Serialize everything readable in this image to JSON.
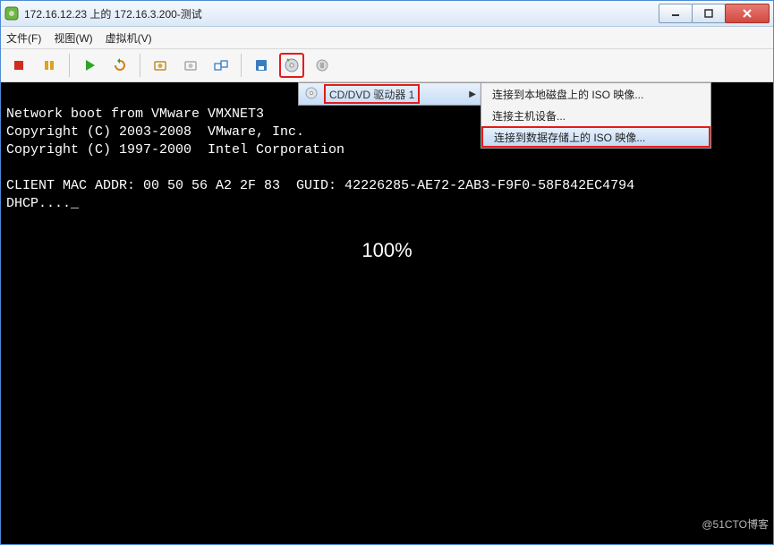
{
  "titlebar": {
    "title": "172.16.12.23 上的 172.16.3.200-测试"
  },
  "menubar": {
    "file": "文件(F)",
    "view": "视图(W)",
    "vm": "虚拟机(V)"
  },
  "dropdown": {
    "item1": "CD/DVD 驱动器 1"
  },
  "submenu": {
    "item1": "连接到本地磁盘上的 ISO 映像...",
    "item2": "连接主机设备...",
    "item3": "连接到数据存储上的 ISO 映像..."
  },
  "console": {
    "line1": "Network boot from VMware VMXNET3",
    "line2": "Copyright (C) 2003-2008  VMware, Inc.",
    "line3": "Copyright (C) 1997-2000  Intel Corporation",
    "line4": "",
    "line5": "CLIENT MAC ADDR: 00 50 56 A2 2F 83  GUID: 42226285-AE72-2AB3-F9F0-58F842EC4794",
    "line6": "DHCP...._",
    "center": "100%"
  },
  "watermark": "@51CTO博客"
}
